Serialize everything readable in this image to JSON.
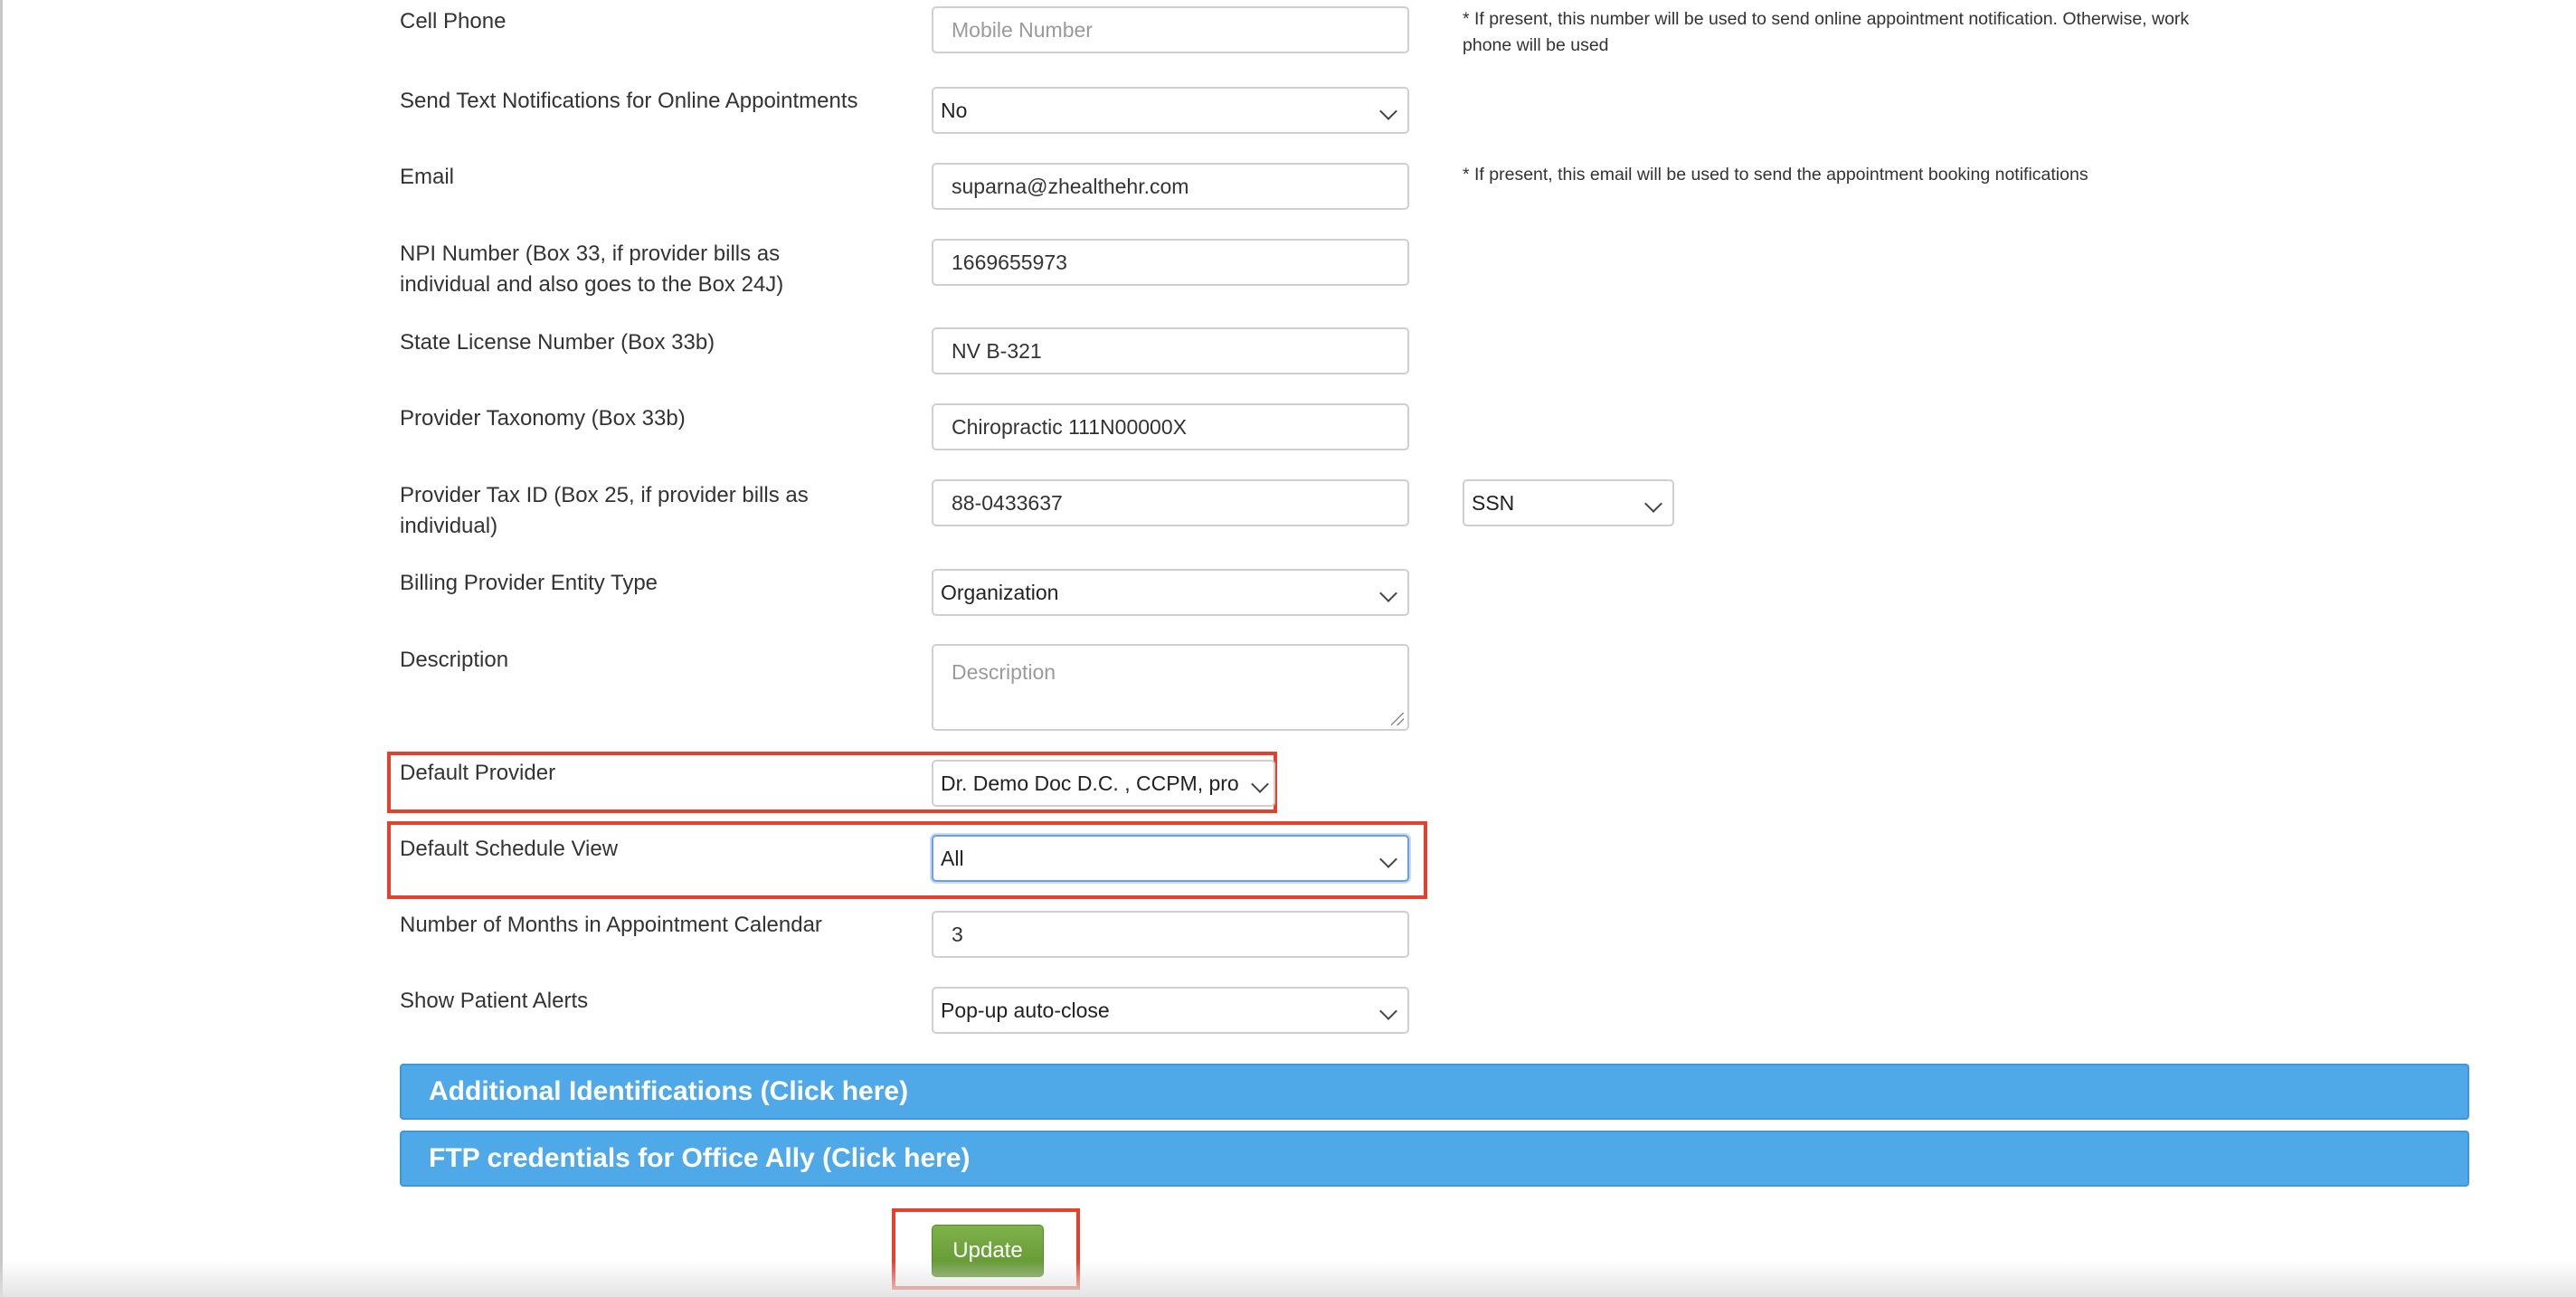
{
  "form": {
    "cell_phone": {
      "label": "Cell Phone",
      "placeholder": "Mobile Number",
      "note": "* If present, this number will be used to send online appointment notification. Otherwise, work phone will be used"
    },
    "text_notifications": {
      "label": "Send Text Notifications for Online Appointments",
      "value": "No"
    },
    "email": {
      "label": "Email",
      "value": "suparna@zhealthehr.com",
      "note": "* If present, this email will be used to send the appointment booking notifications"
    },
    "npi": {
      "label_line1": "NPI Number (Box 33, if provider bills as",
      "label_line2": "individual and also goes to the Box 24J)",
      "value": "1669655973"
    },
    "state_license": {
      "label": "State License Number (Box 33b)",
      "value": "NV B-321"
    },
    "taxonomy": {
      "label": "Provider Taxonomy (Box 33b)",
      "value": "Chiropractic 111N00000X"
    },
    "tax_id": {
      "label_line1": "Provider Tax ID (Box 25, if provider bills as",
      "label_line2": "individual)",
      "value": "88-0433637",
      "type_value": "SSN"
    },
    "entity_type": {
      "label": "Billing Provider Entity Type",
      "value": "Organization"
    },
    "description": {
      "label": "Description",
      "placeholder": "Description"
    },
    "default_provider": {
      "label": "Default Provider",
      "value": "Dr. Demo Doc D.C. , CCPM, pro"
    },
    "default_schedule_view": {
      "label": "Default Schedule View",
      "value": "All"
    },
    "months_in_calendar": {
      "label": "Number of Months in Appointment Calendar",
      "value": "3"
    },
    "patient_alerts": {
      "label": "Show Patient Alerts",
      "value": "Pop-up auto-close"
    }
  },
  "sections": {
    "additional_identifications": "Additional Identifications (Click here)",
    "ftp_credentials": "FTP credentials for Office Ally (Click here)"
  },
  "actions": {
    "update_label": "Update"
  },
  "colors": {
    "accordion": "#4fa9e8",
    "update_button": "#6ea23c",
    "highlight": "#e5412d"
  }
}
